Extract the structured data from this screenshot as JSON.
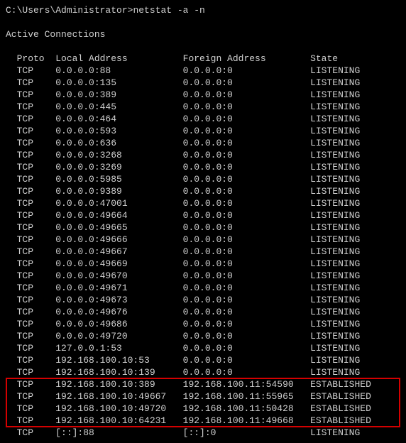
{
  "prompt": "C:\\Users\\Administrator>",
  "command": "netstat -a -n",
  "title": "Active Connections",
  "headers": {
    "proto": "Proto",
    "local": "Local Address",
    "foreign": "Foreign Address",
    "state": "State"
  },
  "rows": [
    {
      "proto": "TCP",
      "local": "0.0.0.0:88",
      "foreign": "0.0.0.0:0",
      "state": "LISTENING",
      "hl": false
    },
    {
      "proto": "TCP",
      "local": "0.0.0.0:135",
      "foreign": "0.0.0.0:0",
      "state": "LISTENING",
      "hl": false
    },
    {
      "proto": "TCP",
      "local": "0.0.0.0:389",
      "foreign": "0.0.0.0:0",
      "state": "LISTENING",
      "hl": false
    },
    {
      "proto": "TCP",
      "local": "0.0.0.0:445",
      "foreign": "0.0.0.0:0",
      "state": "LISTENING",
      "hl": false
    },
    {
      "proto": "TCP",
      "local": "0.0.0.0:464",
      "foreign": "0.0.0.0:0",
      "state": "LISTENING",
      "hl": false
    },
    {
      "proto": "TCP",
      "local": "0.0.0.0:593",
      "foreign": "0.0.0.0:0",
      "state": "LISTENING",
      "hl": false
    },
    {
      "proto": "TCP",
      "local": "0.0.0.0:636",
      "foreign": "0.0.0.0:0",
      "state": "LISTENING",
      "hl": false
    },
    {
      "proto": "TCP",
      "local": "0.0.0.0:3268",
      "foreign": "0.0.0.0:0",
      "state": "LISTENING",
      "hl": false
    },
    {
      "proto": "TCP",
      "local": "0.0.0.0:3269",
      "foreign": "0.0.0.0:0",
      "state": "LISTENING",
      "hl": false
    },
    {
      "proto": "TCP",
      "local": "0.0.0.0:5985",
      "foreign": "0.0.0.0:0",
      "state": "LISTENING",
      "hl": false
    },
    {
      "proto": "TCP",
      "local": "0.0.0.0:9389",
      "foreign": "0.0.0.0:0",
      "state": "LISTENING",
      "hl": false
    },
    {
      "proto": "TCP",
      "local": "0.0.0.0:47001",
      "foreign": "0.0.0.0:0",
      "state": "LISTENING",
      "hl": false
    },
    {
      "proto": "TCP",
      "local": "0.0.0.0:49664",
      "foreign": "0.0.0.0:0",
      "state": "LISTENING",
      "hl": false
    },
    {
      "proto": "TCP",
      "local": "0.0.0.0:49665",
      "foreign": "0.0.0.0:0",
      "state": "LISTENING",
      "hl": false
    },
    {
      "proto": "TCP",
      "local": "0.0.0.0:49666",
      "foreign": "0.0.0.0:0",
      "state": "LISTENING",
      "hl": false
    },
    {
      "proto": "TCP",
      "local": "0.0.0.0:49667",
      "foreign": "0.0.0.0:0",
      "state": "LISTENING",
      "hl": false
    },
    {
      "proto": "TCP",
      "local": "0.0.0.0:49669",
      "foreign": "0.0.0.0:0",
      "state": "LISTENING",
      "hl": false
    },
    {
      "proto": "TCP",
      "local": "0.0.0.0:49670",
      "foreign": "0.0.0.0:0",
      "state": "LISTENING",
      "hl": false
    },
    {
      "proto": "TCP",
      "local": "0.0.0.0:49671",
      "foreign": "0.0.0.0:0",
      "state": "LISTENING",
      "hl": false
    },
    {
      "proto": "TCP",
      "local": "0.0.0.0:49673",
      "foreign": "0.0.0.0:0",
      "state": "LISTENING",
      "hl": false
    },
    {
      "proto": "TCP",
      "local": "0.0.0.0:49676",
      "foreign": "0.0.0.0:0",
      "state": "LISTENING",
      "hl": false
    },
    {
      "proto": "TCP",
      "local": "0.0.0.0:49686",
      "foreign": "0.0.0.0:0",
      "state": "LISTENING",
      "hl": false
    },
    {
      "proto": "TCP",
      "local": "0.0.0.0:49720",
      "foreign": "0.0.0.0:0",
      "state": "LISTENING",
      "hl": false
    },
    {
      "proto": "TCP",
      "local": "127.0.0.1:53",
      "foreign": "0.0.0.0:0",
      "state": "LISTENING",
      "hl": false
    },
    {
      "proto": "TCP",
      "local": "192.168.100.10:53",
      "foreign": "0.0.0.0:0",
      "state": "LISTENING",
      "hl": false
    },
    {
      "proto": "TCP",
      "local": "192.168.100.10:139",
      "foreign": "0.0.0.0:0",
      "state": "LISTENING",
      "hl": false
    },
    {
      "proto": "TCP",
      "local": "192.168.100.10:389",
      "foreign": "192.168.100.11:54590",
      "state": "ESTABLISHED",
      "hl": true
    },
    {
      "proto": "TCP",
      "local": "192.168.100.10:49667",
      "foreign": "192.168.100.11:55965",
      "state": "ESTABLISHED",
      "hl": true
    },
    {
      "proto": "TCP",
      "local": "192.168.100.10:49720",
      "foreign": "192.168.100.11:50428",
      "state": "ESTABLISHED",
      "hl": true
    },
    {
      "proto": "TCP",
      "local": "192.168.100.10:64231",
      "foreign": "192.168.100.11:49668",
      "state": "ESTABLISHED",
      "hl": true
    },
    {
      "proto": "TCP",
      "local": "[::]:88",
      "foreign": "[::]:0",
      "state": "LISTENING",
      "hl": false
    }
  ],
  "cols": {
    "indent": 2,
    "proto_w": 7,
    "local_w": 23,
    "foreign_w": 23
  }
}
